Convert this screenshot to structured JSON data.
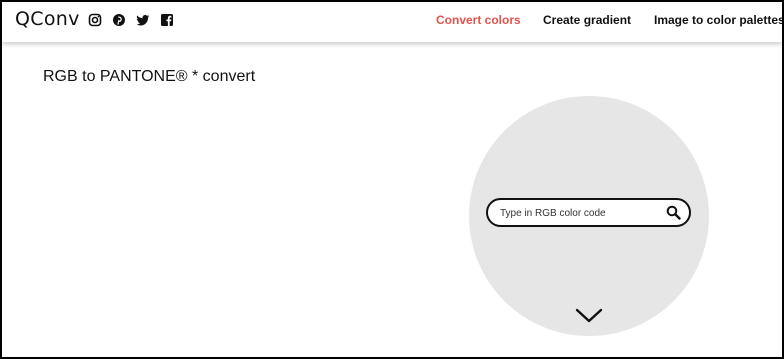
{
  "header": {
    "logo": "QConv",
    "social": [
      {
        "icon": "instagram-icon"
      },
      {
        "icon": "pinterest-icon"
      },
      {
        "icon": "twitter-icon"
      },
      {
        "icon": "facebook-icon"
      }
    ],
    "nav": {
      "convert_colors": "Convert colors",
      "create_gradient": "Create gradient",
      "image_palettes": "Image to color palettes"
    }
  },
  "main": {
    "title": "RGB to PANTONE® * convert",
    "search": {
      "placeholder": "Type in RGB color code",
      "value": ""
    }
  },
  "colors": {
    "accent": "#e0544c",
    "circle": "#e6e6e6"
  }
}
